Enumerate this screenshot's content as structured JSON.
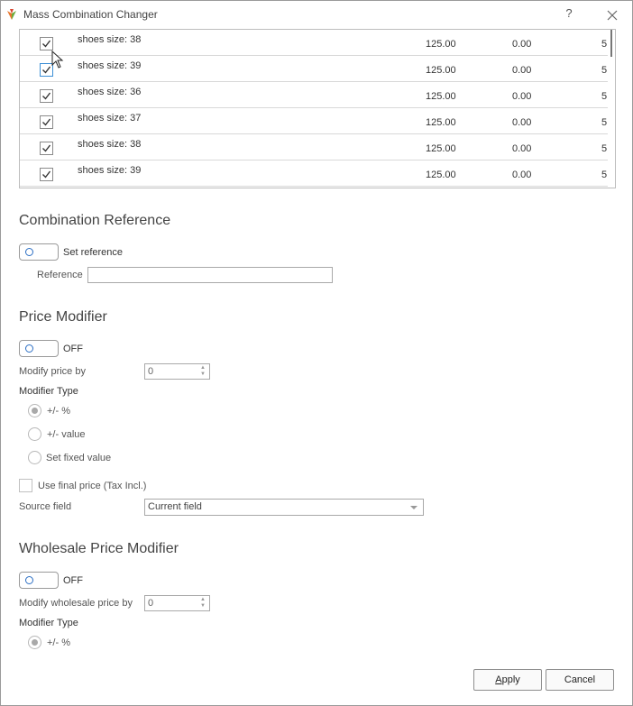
{
  "window": {
    "title": "Mass Combination Changer",
    "help": "?"
  },
  "combinations": {
    "rows": [
      {
        "name": "shoes size: 38",
        "price": "125.00",
        "impact": "0.00",
        "qty": "5",
        "checked": true
      },
      {
        "name": "shoes size: 39",
        "price": "125.00",
        "impact": "0.00",
        "qty": "5",
        "checked": true
      },
      {
        "name": "shoes size: 36",
        "price": "125.00",
        "impact": "0.00",
        "qty": "5",
        "checked": true
      },
      {
        "name": "shoes size: 37",
        "price": "125.00",
        "impact": "0.00",
        "qty": "5",
        "checked": true
      },
      {
        "name": "shoes size: 38",
        "price": "125.00",
        "impact": "0.00",
        "qty": "5",
        "checked": true
      },
      {
        "name": "shoes size: 39",
        "price": "125.00",
        "impact": "0.00",
        "qty": "5",
        "checked": true
      }
    ]
  },
  "reference": {
    "section_title": "Combination Reference",
    "toggle_label": "Set reference",
    "field_label": "Reference",
    "value": ""
  },
  "price": {
    "section_title": "Price Modifier",
    "toggle_label": "OFF",
    "modify_label": "Modify price by",
    "modify_value": "0",
    "type_label": "Modifier Type",
    "options": [
      "+/- %",
      "+/- value",
      "Set fixed value"
    ],
    "selected_index": 0,
    "final_price_label": "Use final price (Tax Incl.)",
    "source_label": "Source field",
    "source_value": "Current field"
  },
  "wholesale": {
    "section_title": "Wholesale Price Modifier",
    "toggle_label": "OFF",
    "modify_label": "Modify wholesale price by",
    "modify_value": "0",
    "type_label": "Modifier Type",
    "options": [
      "+/- %"
    ],
    "selected_index": 0
  },
  "buttons": {
    "apply_prefix": "",
    "apply_hotkey": "A",
    "apply_rest": "pply",
    "cancel": "Cancel"
  },
  "colors": {
    "accent": "#2c6fc4",
    "border": "#a9a9a9"
  }
}
